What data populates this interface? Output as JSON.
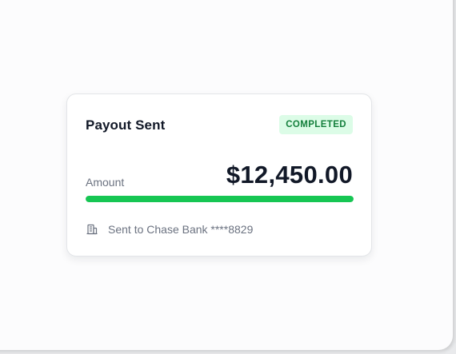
{
  "card": {
    "title": "Payout Sent",
    "status": "COMPLETED",
    "amount_label": "Amount",
    "amount": "$12,450.00",
    "progress": 1.0,
    "destination": "Sent to Chase Bank ****8829",
    "icon": "bank-icon"
  },
  "colors": {
    "badge_bg": "#dcfce7",
    "badge_text": "#15803d",
    "progress_fill": "#16c653"
  }
}
